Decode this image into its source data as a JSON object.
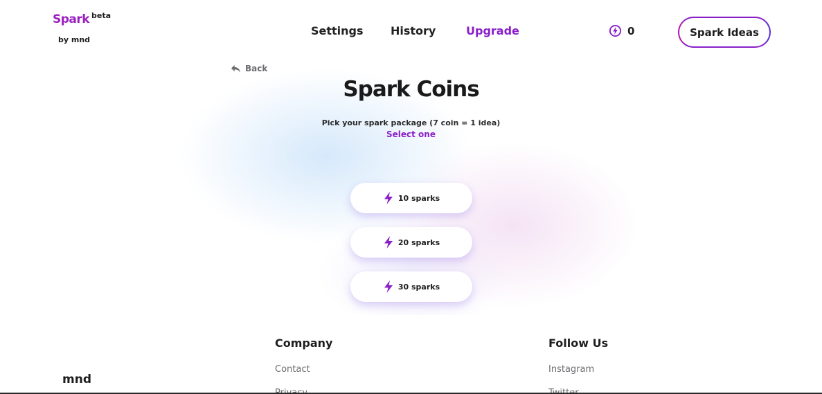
{
  "header": {
    "logo": {
      "name": "Spark",
      "badge": "beta",
      "byline": "by mnd"
    },
    "nav": [
      {
        "label": "Settings"
      },
      {
        "label": "History"
      },
      {
        "label": "Upgrade"
      }
    ],
    "coin_count": "0",
    "cta_label": "Spark Ideas"
  },
  "main": {
    "back_label": "Back",
    "title": "Spark Coins",
    "subtitle": "Pick your spark package (7 coin = 1 idea)",
    "select_label": "Select one",
    "packages": [
      {
        "label": "10 sparks",
        "icon": "bolt-icon"
      },
      {
        "label": "20 sparks",
        "icon": "bolt-icon"
      },
      {
        "label": "30 sparks",
        "icon": "bolt-icon"
      }
    ]
  },
  "footer": {
    "brand": "mnd",
    "columns": [
      {
        "heading": "Company",
        "links": [
          "Contact",
          "Privacy"
        ]
      },
      {
        "heading": "Follow Us",
        "links": [
          "Instagram",
          "Twitter"
        ]
      }
    ]
  },
  "colors": {
    "accent": "#8a1fc9",
    "brand": "#9b1fbf",
    "muted_text": "#6d6d72"
  }
}
